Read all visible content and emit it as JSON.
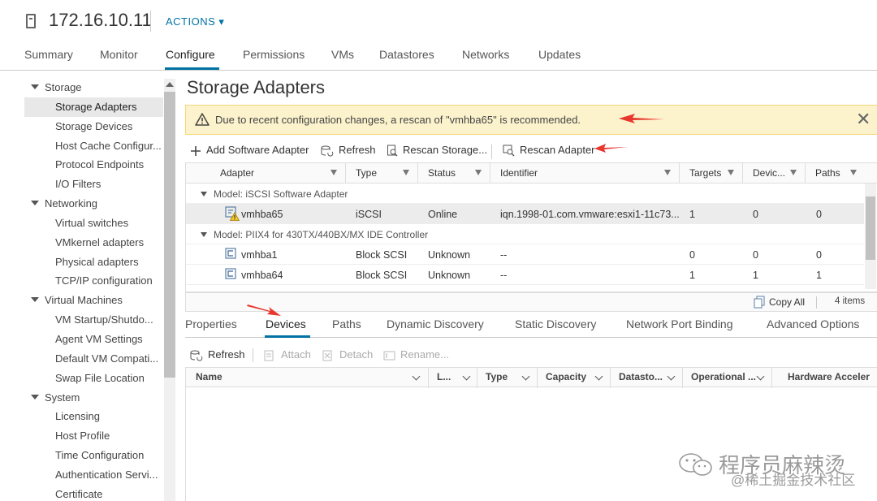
{
  "header": {
    "host_name": "172.16.10.11",
    "actions_label": "ACTIONS ▾"
  },
  "nav": {
    "tabs": [
      "Summary",
      "Monitor",
      "Configure",
      "Permissions",
      "VMs",
      "Datastores",
      "Networks",
      "Updates"
    ],
    "active": "Configure"
  },
  "sidebar": {
    "groups": [
      {
        "label": "Storage",
        "items": [
          "Storage Adapters",
          "Storage Devices",
          "Host Cache Configur...",
          "Protocol Endpoints",
          "I/O Filters"
        ]
      },
      {
        "label": "Networking",
        "items": [
          "Virtual switches",
          "VMkernel adapters",
          "Physical adapters",
          "TCP/IP configuration"
        ]
      },
      {
        "label": "Virtual Machines",
        "items": [
          "VM Startup/Shutdo...",
          "Agent VM Settings",
          "Default VM Compati...",
          "Swap File Location"
        ]
      },
      {
        "label": "System",
        "items": [
          "Licensing",
          "Host Profile",
          "Time Configuration",
          "Authentication Servi...",
          "Certificate"
        ]
      }
    ],
    "selected": "Storage Adapters"
  },
  "main": {
    "title": "Storage Adapters",
    "alert": "Due to recent configuration changes, a rescan of \"vmhba65\" is recommended.",
    "alert_close": "✕",
    "toolbar": {
      "add_software_adapter": "Add Software Adapter",
      "refresh": "Refresh",
      "rescan_storage": "Rescan Storage...",
      "rescan_adapter": "Rescan Adapter"
    },
    "grid": {
      "columns": [
        "Adapter",
        "Type",
        "Status",
        "Identifier",
        "Targets",
        "Devic...",
        "Paths"
      ],
      "groups": [
        {
          "label": "Model: iSCSI Software Adapter",
          "rows": [
            {
              "adapter": "vmhba65",
              "type": "iSCSI",
              "status": "Online",
              "identifier": "iqn.1998-01.com.vmware:esxi1-11c73...",
              "targets": "1",
              "devices": "0",
              "paths": "0"
            }
          ]
        },
        {
          "label": "Model: PIIX4 for 430TX/440BX/MX IDE Controller",
          "rows": [
            {
              "adapter": "vmhba1",
              "type": "Block SCSI",
              "status": "Unknown",
              "identifier": "--",
              "targets": "0",
              "devices": "0",
              "paths": "0"
            },
            {
              "adapter": "vmhba64",
              "type": "Block SCSI",
              "status": "Unknown",
              "identifier": "--",
              "targets": "1",
              "devices": "1",
              "paths": "1"
            }
          ]
        }
      ],
      "copy_all": "Copy All",
      "item_count": "4 items"
    },
    "detail_tabs": [
      "Properties",
      "Devices",
      "Paths",
      "Dynamic Discovery",
      "Static Discovery",
      "Network Port Binding",
      "Advanced Options"
    ],
    "detail_active": "Devices",
    "detail_toolbar": {
      "refresh": "Refresh",
      "attach": "Attach",
      "detach": "Detach",
      "rename": "Rename..."
    },
    "device_columns": [
      "Name",
      "L...",
      "Type",
      "Capacity",
      "Datasto...",
      "Operational ...",
      "Hardware Acceler"
    ]
  },
  "watermark": {
    "line1": "程序员麻辣烫",
    "line2": "@稀土掘金技术社区"
  },
  "colors": {
    "accent": "#0072a3",
    "alert_bg": "#fcf3cd",
    "annotation_arrow": "#e8382e"
  }
}
